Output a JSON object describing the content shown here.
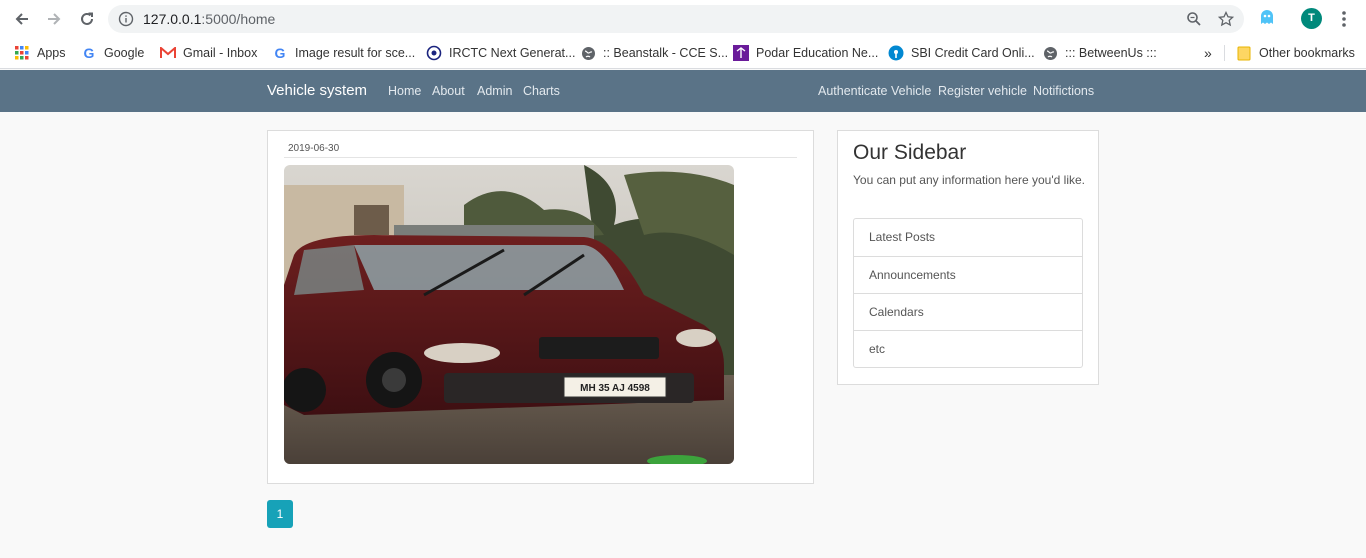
{
  "browser": {
    "url_host": "127.0.0.1",
    "url_path": ":5000/home",
    "avatar_letter": "T"
  },
  "bookmarks": [
    {
      "label": "Apps",
      "icon": "apps-grid-icon"
    },
    {
      "label": "Google",
      "icon": "google-icon"
    },
    {
      "label": "Gmail - Inbox",
      "icon": "gmail-icon"
    },
    {
      "label": "Image result for sce...",
      "icon": "google-icon"
    },
    {
      "label": "IRCTC Next Generat...",
      "icon": "irctc-icon"
    },
    {
      "label": ":: Beanstalk - CCE S...",
      "icon": "globe-icon"
    },
    {
      "label": "Podar Education Ne...",
      "icon": "podar-icon"
    },
    {
      "label": "SBI Credit Card Onli...",
      "icon": "sbi-icon"
    },
    {
      "label": "::: BetweenUs :::",
      "icon": "globe-icon"
    }
  ],
  "bookmarks_overflow": "»",
  "other_bookmarks": "Other bookmarks",
  "navbar": {
    "brand": "Vehicle system",
    "left_links": [
      "Home",
      "About",
      "Admin",
      "Charts"
    ],
    "right_links": [
      "Authenticate Vehicle",
      "Register vehicle",
      "Notifictions"
    ]
  },
  "post": {
    "date": "2019-06-30",
    "plate_text": "MH 35 AJ 4598"
  },
  "sidebar": {
    "title": "Our Sidebar",
    "text": "You can put any information here you'd like.",
    "items": [
      "Latest Posts",
      "Announcements",
      "Calendars",
      "etc"
    ]
  },
  "pagination": {
    "current": "1"
  },
  "colors": {
    "navbar": "#5a7387",
    "page_button": "#17a2b8",
    "background": "#f9f9f9"
  }
}
